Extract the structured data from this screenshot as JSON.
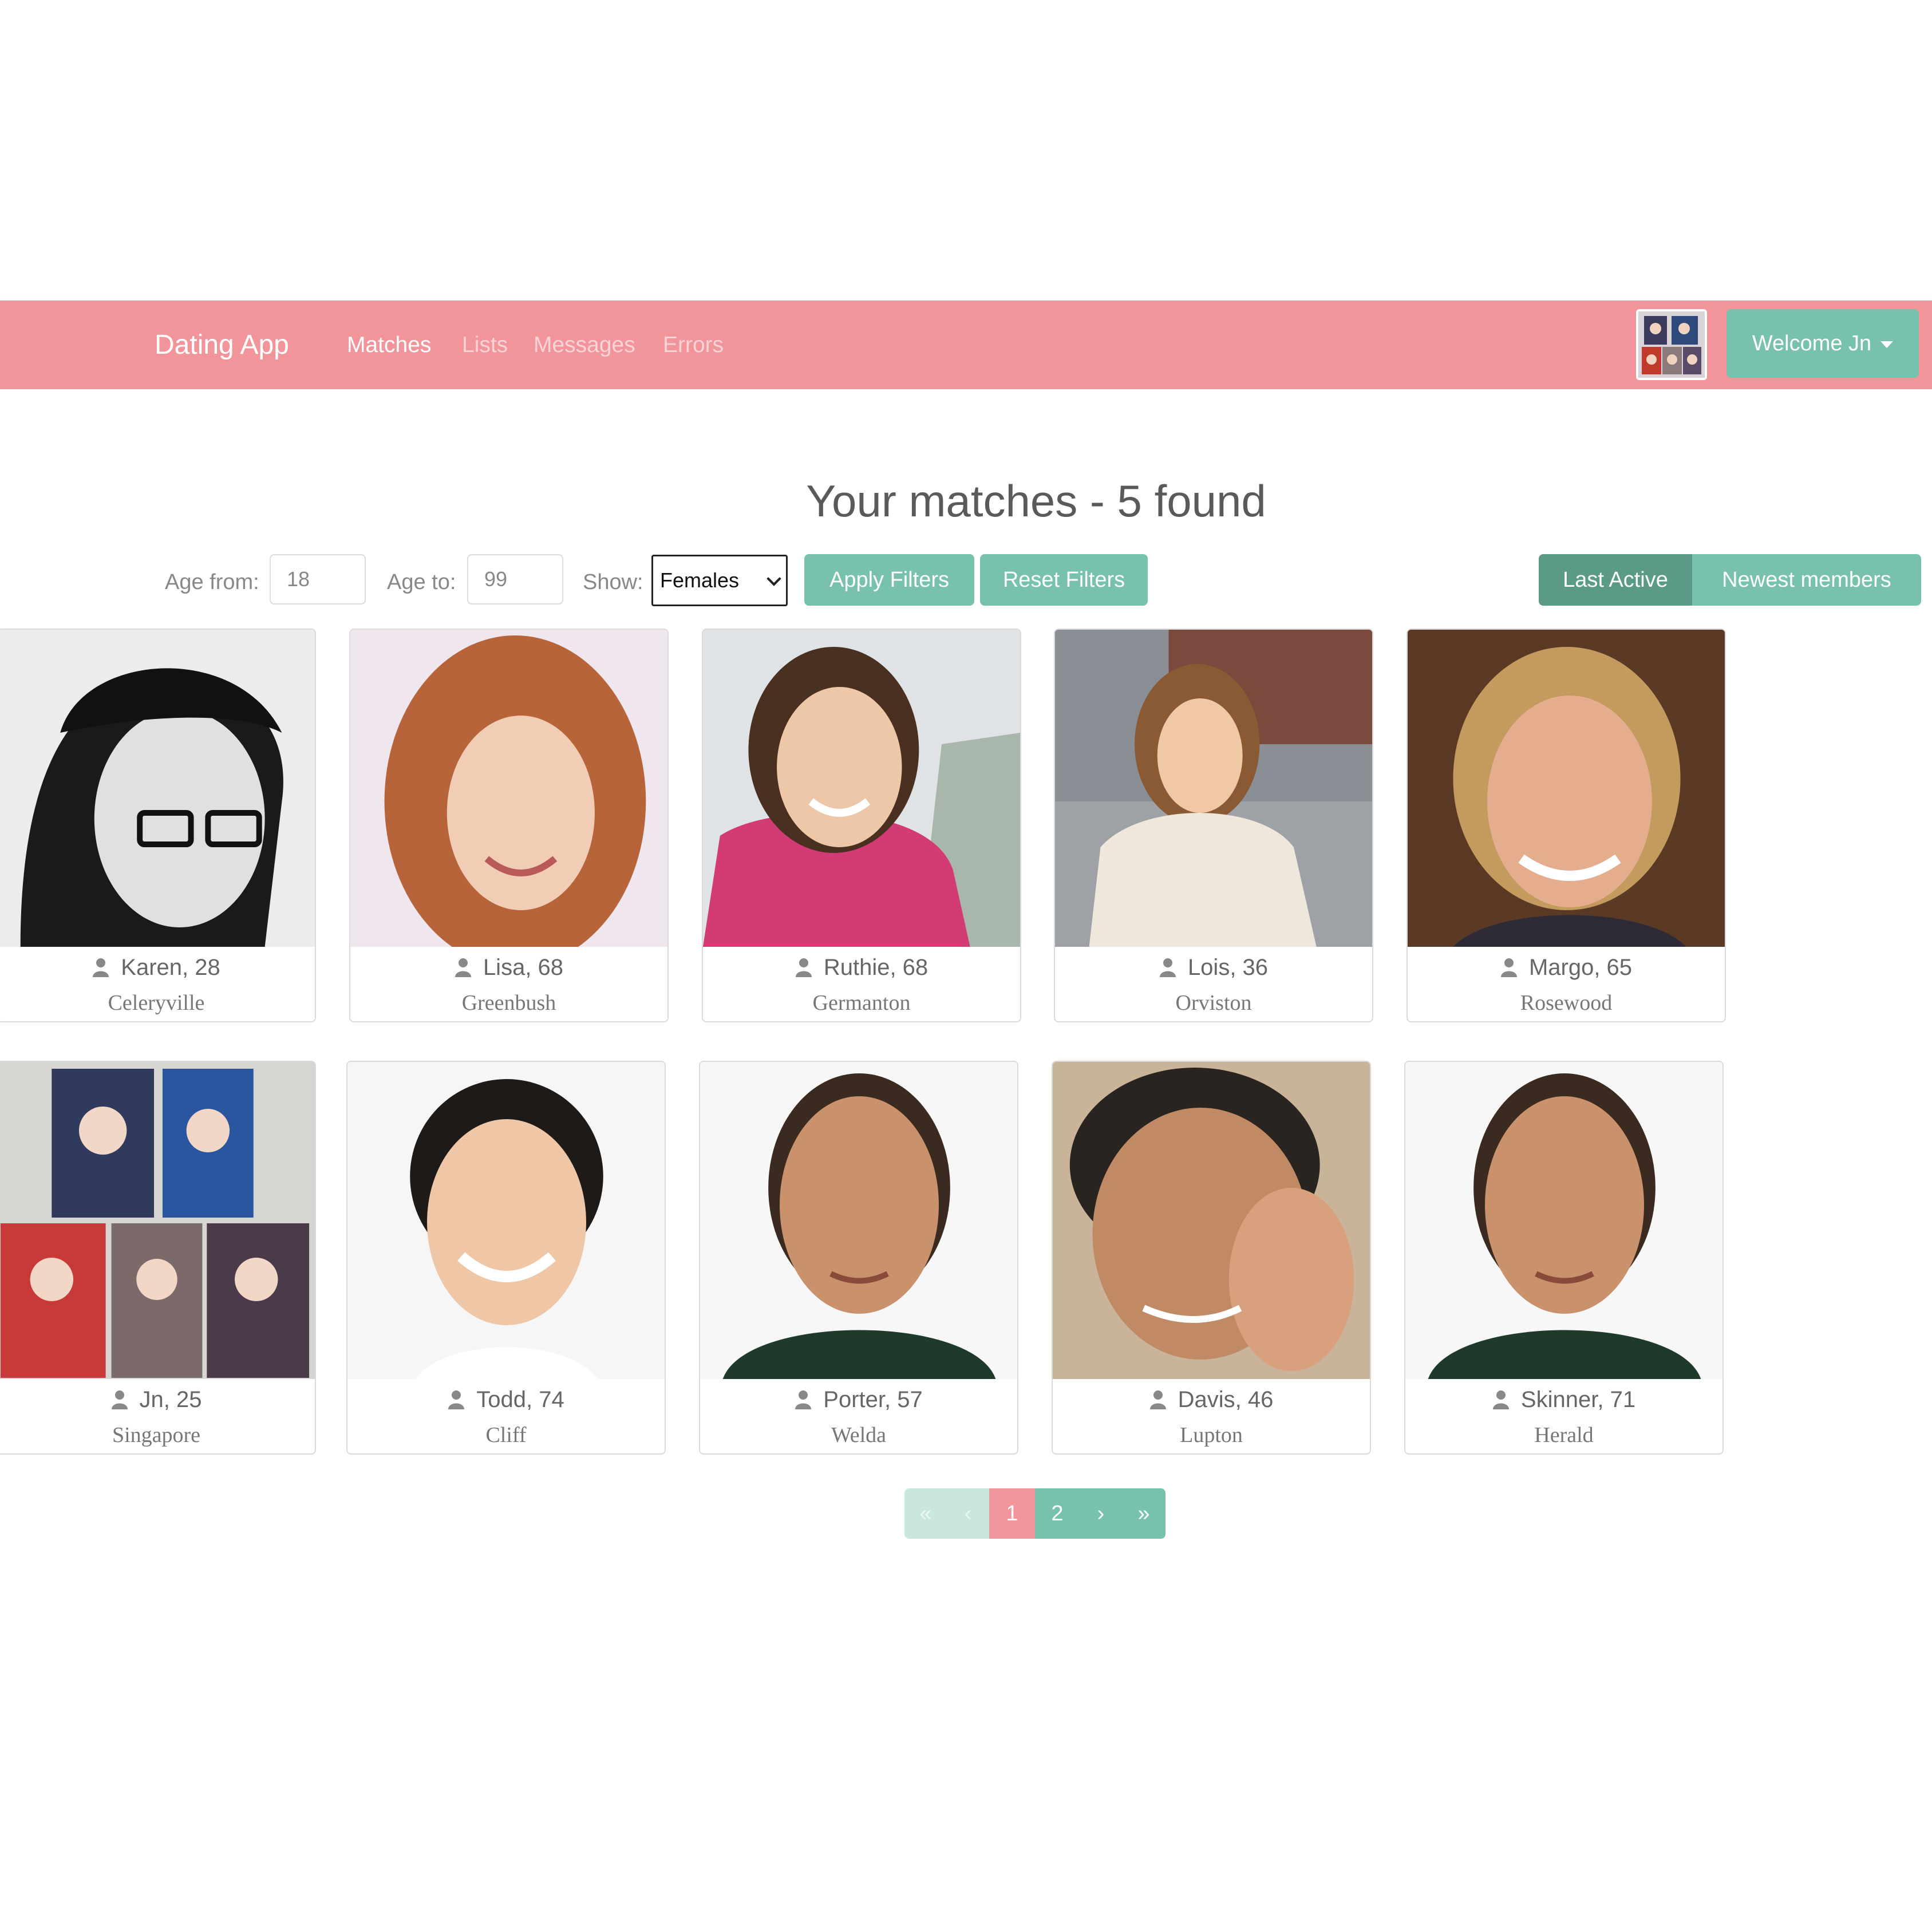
{
  "navbar": {
    "brand": "Dating App",
    "links": [
      "Matches",
      "Lists",
      "Messages",
      "Errors"
    ],
    "welcome": "Welcome Jn",
    "colors": {
      "navbar": "#f1959b",
      "accent": "#78c2ad"
    }
  },
  "page": {
    "title": "Your matches - 5 found"
  },
  "filters": {
    "age_from_label": "Age from:",
    "age_from_value": "18",
    "age_to_label": "Age to:",
    "age_to_value": "99",
    "show_label": "Show:",
    "show_value": "Females",
    "apply": "Apply Filters",
    "reset": "Reset Filters"
  },
  "sort": {
    "last_active": "Last Active",
    "newest": "Newest members",
    "selected": "Last Active"
  },
  "members": [
    {
      "name": "Karen, 28",
      "city": "Celeryville"
    },
    {
      "name": "Lisa, 68",
      "city": "Greenbush"
    },
    {
      "name": "Ruthie, 68",
      "city": "Germanton"
    },
    {
      "name": "Lois, 36",
      "city": "Orviston"
    },
    {
      "name": "Margo, 65",
      "city": "Rosewood"
    },
    {
      "name": "Jn, 25",
      "city": "Singapore"
    },
    {
      "name": "Todd, 74",
      "city": "Cliff"
    },
    {
      "name": "Porter, 57",
      "city": "Welda"
    },
    {
      "name": "Davis, 46",
      "city": "Lupton"
    },
    {
      "name": "Skinner, 71",
      "city": "Herald"
    }
  ],
  "pagination": {
    "first": "«",
    "prev": "‹",
    "pages": [
      "1",
      "2"
    ],
    "current": "1",
    "next": "›",
    "last": "»"
  }
}
